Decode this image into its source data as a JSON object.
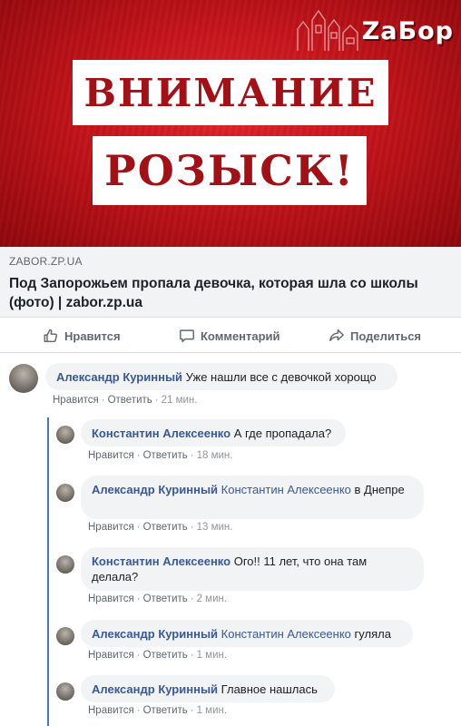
{
  "link_preview": {
    "image": {
      "banner_line1": "ВНИМАНИЕ",
      "banner_line2": "РОЗЫСК!",
      "logo_text": "ZaБор"
    },
    "domain": "ZABOR.ZP.UA",
    "title": "Под Запорожьем пропала девочка, которая шла со школы (фото) | zabor.zp.ua"
  },
  "actions": {
    "like": "Нравится",
    "comment": "Комментарий",
    "share": "Поделиться"
  },
  "comment_meta": {
    "like": "Нравится",
    "reply": "Ответить"
  },
  "comments": [
    {
      "author": "Александр Куринный",
      "mention": "",
      "text": "Уже нашли все с девочкой хорощо",
      "time": "21 мин."
    },
    {
      "author": "Константин Алексеенко",
      "mention": "",
      "text": "А где пропадала?",
      "time": "18 мин."
    },
    {
      "author": "Александр Куринный",
      "mention": "Константин Алексеенко",
      "text": "в Днепре",
      "time": "13 мин."
    },
    {
      "author": "Константин Алексеенко",
      "mention": "",
      "text": "Ого!! 11 лет, что она там делала?",
      "time": "2 мин."
    },
    {
      "author": "Александр Куринный",
      "mention": "Константин Алексеенко",
      "text": "гуляла",
      "time": "1 мин."
    },
    {
      "author": "Александр Куринный",
      "mention": "",
      "text": "Главное нашлась",
      "time": "1 мин."
    }
  ],
  "colors": {
    "accent_red": "#c4141b",
    "link_blue": "#385898",
    "thread_blue": "#4a76c3",
    "bubble_gray": "#f2f3f5"
  }
}
